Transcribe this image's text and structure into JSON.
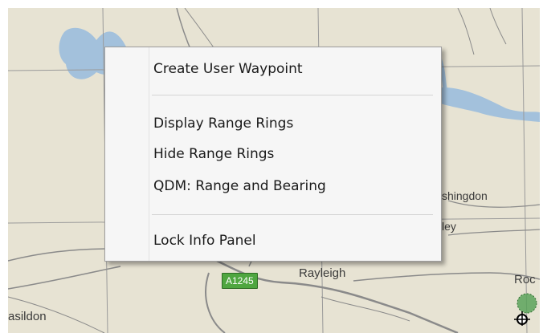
{
  "map": {
    "places": [
      {
        "name": "Rayleigh"
      },
      {
        "name": "asildon"
      },
      {
        "name": "shingdon"
      },
      {
        "name": "ley"
      },
      {
        "name": "Roc"
      }
    ],
    "roads": [
      {
        "ref": "A1245"
      }
    ],
    "colors": {
      "land": "#e7e3d3",
      "water": "#a3c1dc",
      "grid": "#9a9a9a",
      "road": "#7a7a7a",
      "shield": "#4fa640"
    }
  },
  "context_menu": {
    "items": [
      {
        "label": "Create User Waypoint"
      },
      {
        "label": "Display Range Rings"
      },
      {
        "label": "Hide Range Rings"
      },
      {
        "label": "QDM: Range and Bearing"
      },
      {
        "label": "Lock Info Panel"
      }
    ]
  }
}
